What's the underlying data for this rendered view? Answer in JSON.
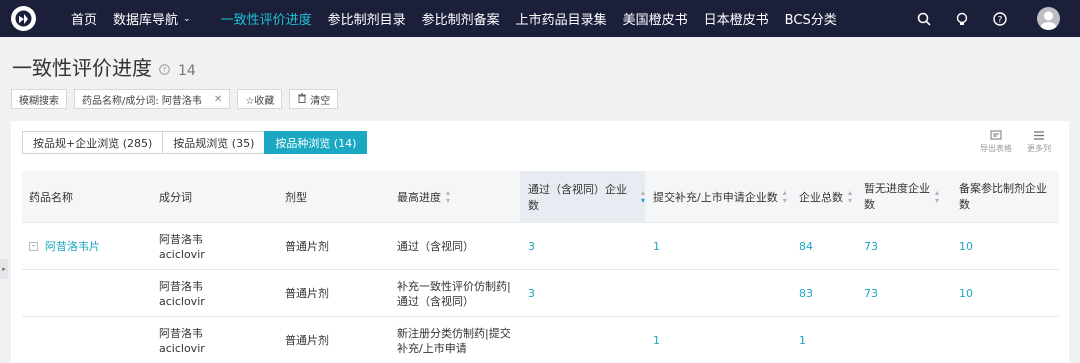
{
  "nav": {
    "items": [
      {
        "label": "首页",
        "active": false
      },
      {
        "label": "数据库导航",
        "active": false,
        "dropdown": true
      },
      {
        "label": "一致性评价进度",
        "active": true
      },
      {
        "label": "参比制剂目录",
        "active": false
      },
      {
        "label": "参比制剂备案",
        "active": false
      },
      {
        "label": "上市药品目录集",
        "active": false
      },
      {
        "label": "美国橙皮书",
        "active": false
      },
      {
        "label": "日本橙皮书",
        "active": false
      },
      {
        "label": "BCS分类",
        "active": false
      }
    ],
    "icons": [
      "search-icon",
      "bulb-icon",
      "help-icon",
      "avatar"
    ],
    "colors": {
      "bg": "#1b1f3a",
      "active": "#1ec1d6"
    }
  },
  "page": {
    "title": "一致性评价进度",
    "count": "14"
  },
  "filters": {
    "fuzzy_search": "模糊搜索",
    "keyword_chip": "药品名称/成分词:   阿昔洛韦",
    "favorite": "☆收藏",
    "clear": "清空"
  },
  "tabs": [
    {
      "label": "按品规+企业浏览 (285)",
      "active": false
    },
    {
      "label": "按品规浏览 (35)",
      "active": false
    },
    {
      "label": "按品种浏览 (14)",
      "active": true
    }
  ],
  "tools": {
    "export": "导出表格",
    "more_columns": "更多列"
  },
  "table": {
    "headers": [
      "药品名称",
      "成分词",
      "剂型",
      "最高进度",
      "通过（含视同）企业数",
      "提交补充/上市申请企业数",
      "企业总数",
      "暂无进度企业数",
      "备案参比制剂企业数"
    ],
    "rows": [
      {
        "name": "阿昔洛韦片",
        "ingredient_cn": "阿昔洛韦",
        "ingredient_en": "aciclovir",
        "form": "普通片剂",
        "progress": "通过（含视同）",
        "passed": "3",
        "submitted": "1",
        "total": "84",
        "no_progress": "73",
        "ref_filed": "10"
      },
      {
        "name": "",
        "ingredient_cn": "阿昔洛韦",
        "ingredient_en": "aciclovir",
        "form": "普通片剂",
        "progress": "补充一致性评价仿制药|通过（含视同）",
        "passed": "3",
        "submitted": "",
        "total": "83",
        "no_progress": "73",
        "ref_filed": "10"
      },
      {
        "name": "",
        "ingredient_cn": "阿昔洛韦",
        "ingredient_en": "aciclovir",
        "form": "普通片剂",
        "progress": "新注册分类仿制药|提交补充/上市申请",
        "passed": "",
        "submitted": "1",
        "total": "1",
        "no_progress": "",
        "ref_filed": ""
      }
    ],
    "expander": "-"
  }
}
